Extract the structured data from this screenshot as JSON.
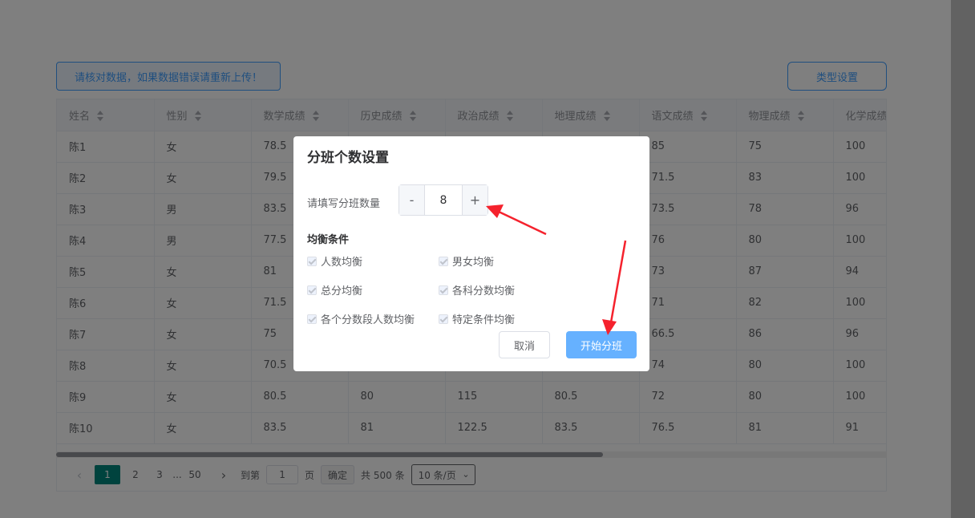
{
  "toolbar": {
    "notice_label": "请核对数据，如果数据错误请重新上传！",
    "type_settings_label": "类型设置"
  },
  "table": {
    "columns": [
      "姓名",
      "性别",
      "数学成绩",
      "历史成绩",
      "政治成绩",
      "地理成绩",
      "语文成绩",
      "物理成绩",
      "化学成绩"
    ],
    "rows": [
      [
        "陈1",
        "女",
        "78.5",
        "",
        "",
        "",
        "85",
        "75",
        "100"
      ],
      [
        "陈2",
        "女",
        "79.5",
        "",
        "",
        "",
        "71.5",
        "83",
        "100"
      ],
      [
        "陈3",
        "男",
        "83.5",
        "",
        "",
        "",
        "73.5",
        "78",
        "96"
      ],
      [
        "陈4",
        "男",
        "77.5",
        "",
        "",
        "",
        "76",
        "80",
        "100"
      ],
      [
        "陈5",
        "女",
        "81",
        "",
        "",
        "",
        "73",
        "87",
        "94"
      ],
      [
        "陈6",
        "女",
        "71.5",
        "",
        "",
        "",
        "71",
        "82",
        "100"
      ],
      [
        "陈7",
        "女",
        "75",
        "",
        "",
        "",
        "66.5",
        "86",
        "96"
      ],
      [
        "陈8",
        "女",
        "70.5",
        "",
        "",
        "",
        "74",
        "80",
        "100"
      ],
      [
        "陈9",
        "女",
        "80.5",
        "80",
        "115",
        "80.5",
        "72",
        "80",
        "100"
      ],
      [
        "陈10",
        "女",
        "83.5",
        "81",
        "122.5",
        "83.5",
        "76.5",
        "81",
        "91"
      ]
    ]
  },
  "pagination": {
    "prev_icon": "chevron-left-icon",
    "pages": [
      "1",
      "2",
      "3"
    ],
    "ellipsis": "...",
    "last_page": "50",
    "next_icon": "chevron-right-icon",
    "goto_label": "到第",
    "goto_value": "1",
    "page_unit": "页",
    "confirm_label": "确定",
    "total_label": "共 500 条",
    "page_size": "10 条/页",
    "active_color": "#00867c"
  },
  "dialog": {
    "title": "分班个数设置",
    "fill_label": "请填写分班数量",
    "minus_label": "-",
    "count": "8",
    "plus_label": "+",
    "conditions_title": "均衡条件",
    "conditions": [
      "人数均衡",
      "男女均衡",
      "总分均衡",
      "各科分数均衡",
      "各个分数段人数均衡",
      "特定条件均衡"
    ],
    "cancel_label": "取消",
    "start_label": "开始分班",
    "primary_color": "#66b1ff"
  },
  "annotations": {
    "arrow_color": "#f5222d"
  }
}
